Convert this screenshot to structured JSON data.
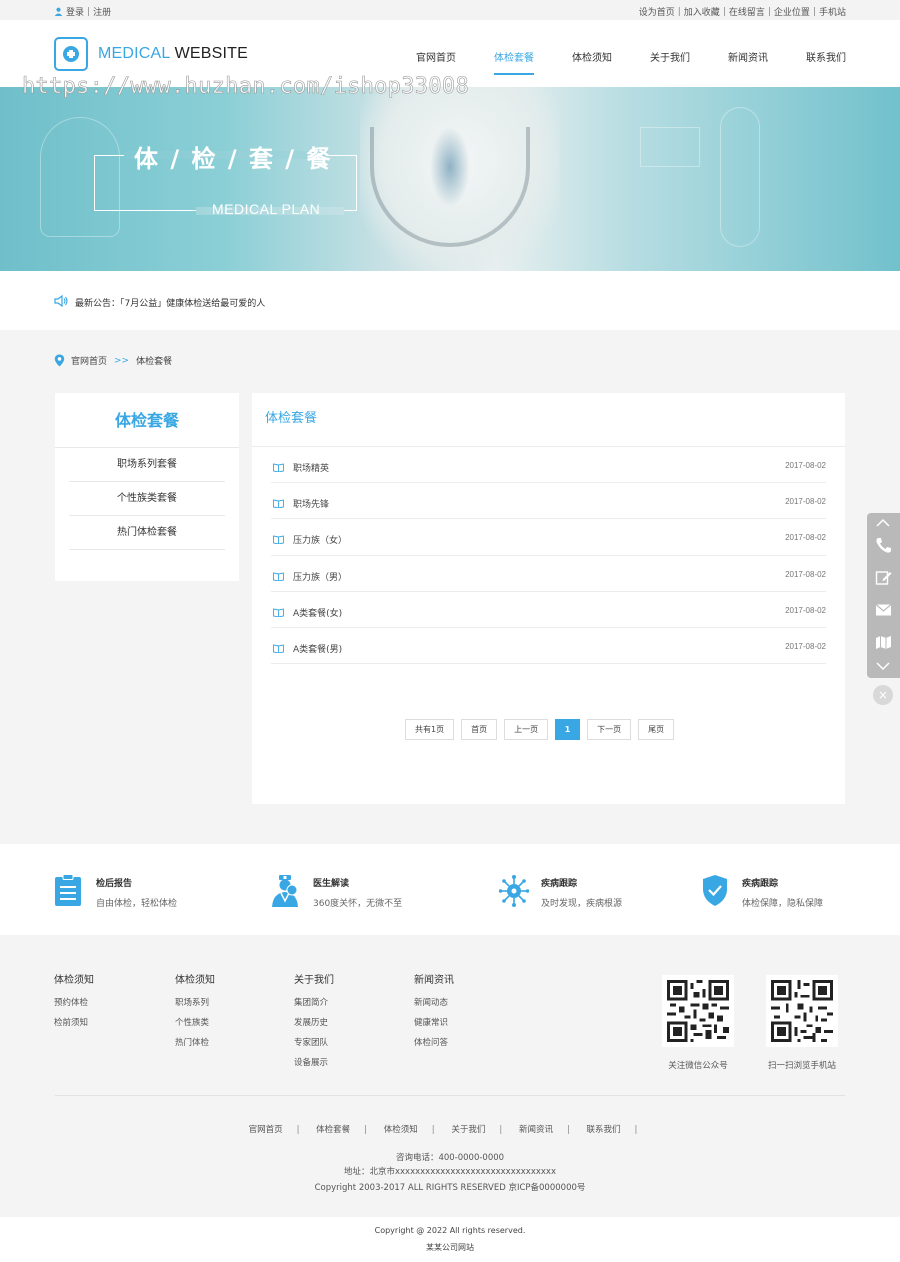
{
  "topbar": {
    "login": "登录",
    "register": "注册",
    "links": [
      "设为首页",
      "加入收藏",
      "在线留言",
      "企业位置",
      "手机站"
    ]
  },
  "header": {
    "logo_medical": "MEDICAL",
    "logo_website": "WEBSITE",
    "nav": [
      "官网首页",
      "体检套餐",
      "体检须知",
      "关于我们",
      "新闻资讯",
      "联系我们"
    ],
    "active_nav": "体检套餐"
  },
  "watermark": "https://www.huzhan.com/ishop33008",
  "banner": {
    "title": "体 / 检 / 套 / 餐",
    "subtitle": "MEDICAL PLAN"
  },
  "notice": {
    "text": "最新公告：「7月公益」健康体检送给最可爱的人"
  },
  "breadcrumb": {
    "home": "官网首页",
    "arrows": ">>",
    "current": "体检套餐"
  },
  "sidebar": {
    "title": "体检套餐",
    "items": [
      "职场系列套餐",
      "个性族类套餐",
      "热门体检套餐"
    ]
  },
  "content": {
    "title": "体检套餐",
    "rows": [
      {
        "title": "职场精英",
        "date": "2017-08-02"
      },
      {
        "title": "职场先锋",
        "date": "2017-08-02"
      },
      {
        "title": "压力族（女）",
        "date": "2017-08-02"
      },
      {
        "title": "压力族（男）",
        "date": "2017-08-02"
      },
      {
        "title": "A类套餐(女)",
        "date": "2017-08-02"
      },
      {
        "title": "A类套餐(男)",
        "date": "2017-08-02"
      }
    ],
    "pager": {
      "total": "共有1页",
      "first": "首页",
      "prev": "上一页",
      "current": "1",
      "next": "下一页",
      "last": "尾页"
    }
  },
  "float_close": "×",
  "features": [
    {
      "title": "检后报告",
      "desc": "自由体检，轻松体检",
      "icon": "clipboard-icon"
    },
    {
      "title": "医生解读",
      "desc": "360度关怀，无微不至",
      "icon": "doctor-icon"
    },
    {
      "title": "疾病跟踪",
      "desc": "及时发现，疾病根源",
      "icon": "virus-icon"
    },
    {
      "title": "疾病跟踪",
      "desc": "体检保障，隐私保障",
      "icon": "shield-icon"
    }
  ],
  "footer": {
    "columns": [
      {
        "title": "体检须知",
        "links": [
          "预约体检",
          "检前须知"
        ]
      },
      {
        "title": "体检须知",
        "links": [
          "职场系列",
          "个性族类",
          "热门体检"
        ]
      },
      {
        "title": "关于我们",
        "links": [
          "集团简介",
          "发展历史",
          "专家团队",
          "设备展示"
        ]
      },
      {
        "title": "新闻资讯",
        "links": [
          "新闻动态",
          "健康常识",
          "体检问答"
        ]
      }
    ],
    "qr": [
      "关注微信公众号",
      "扫一扫浏览手机站"
    ],
    "nav": [
      "官网首页",
      "体检套餐",
      "体检须知",
      "关于我们",
      "新闻资讯",
      "联系我们"
    ],
    "phone": "咨询电话：400-0000-0000",
    "address": "地址：北京市xxxxxxxxxxxxxxxxxxxxxxxxxxxxxxxx",
    "copyright": "Copyright 2003-2017 ALL RIGHTS RESERVED 京ICP备0000000号"
  },
  "bottom": {
    "line1": "Copyright @ 2022   All rights reserved.",
    "line2": "某某公司网站"
  },
  "colors": {
    "accent": "#39a7e3"
  }
}
